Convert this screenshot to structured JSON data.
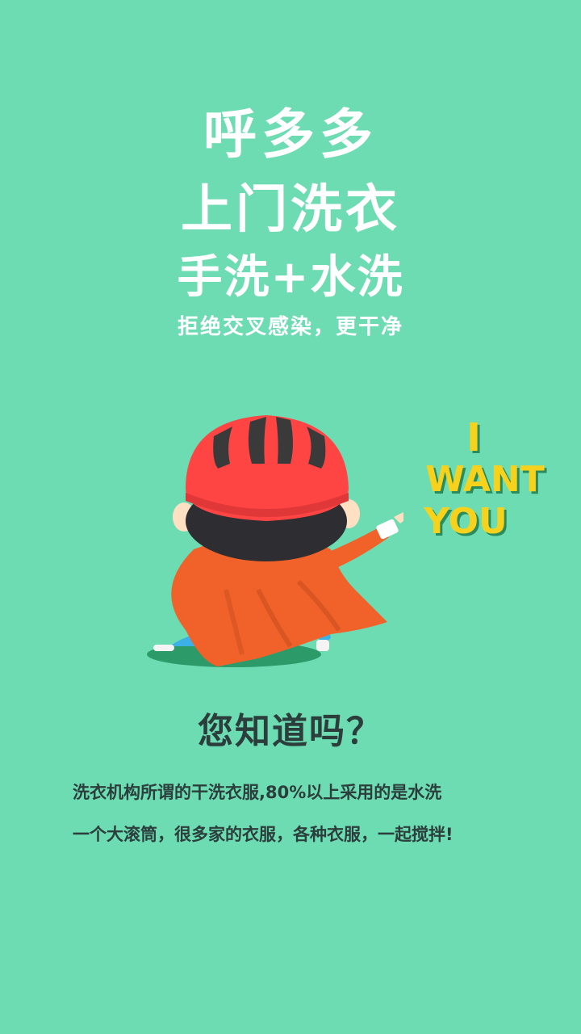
{
  "headline": {
    "brand": "呼多多",
    "service": "上门洗衣",
    "method": "手洗+水洗",
    "tagline": "拒绝交叉感染，更干净"
  },
  "illustration": {
    "speech": [
      "I",
      "WANT",
      "YOU"
    ],
    "colors": {
      "background": "#6ddcb3",
      "helmet": "#ff4444",
      "cape": "#f0622a",
      "shadow": "#2d9a6a",
      "text": "#f7d21d"
    }
  },
  "info": {
    "question": "您知道吗？",
    "paragraph": [
      "洗衣机构所谓的干洗衣服,80%以上采用的是水洗",
      "一个大滚筒，很多家的衣服，各种衣服，一起搅拌!"
    ]
  }
}
